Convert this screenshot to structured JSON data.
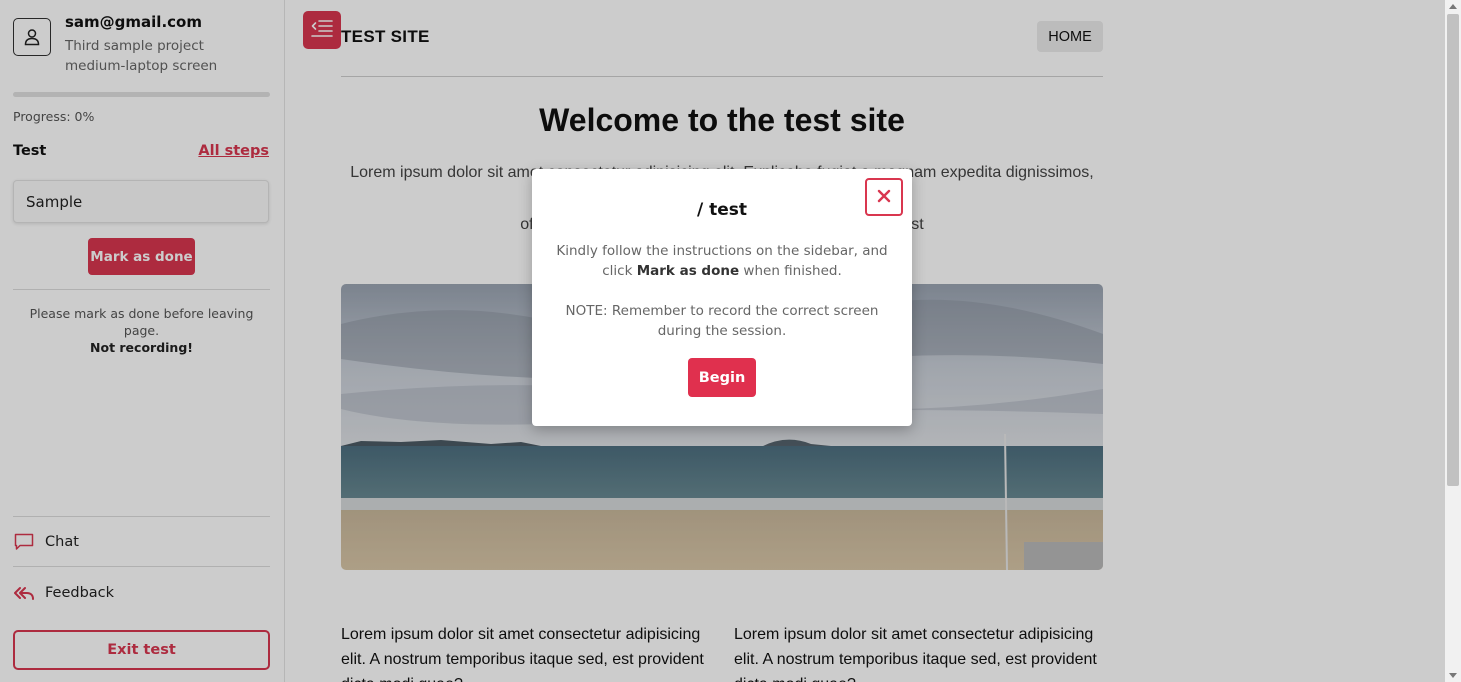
{
  "sidebar": {
    "user_email": "sam@gmail.com",
    "project_name": "Third sample project",
    "screen_type": "medium-laptop screen",
    "progress_value": 0,
    "progress_label": "Progress: 0%",
    "step_title": "Test",
    "all_steps_label": "All steps",
    "step_item": "Sample",
    "mark_done_label": "Mark as done",
    "warning_text": "Please mark as done before leaving page.",
    "warning_bold": "Not recording!",
    "chat_label": "Chat",
    "feedback_label": "Feedback",
    "exit_label": "Exit test",
    "accent_color": "#d9364f",
    "icons": [
      "user-icon",
      "chat-icon",
      "reply-all-icon",
      "menu-collapse-icon"
    ]
  },
  "site": {
    "title": "TEST SITE",
    "home_label": "HOME",
    "hero_title": "Welcome to the test site",
    "hero_text_line1": "Lorem ipsum dolor sit amet consectetur adipisicing elit. Explicabo fugiat a magnam expedita dignissimos, nobis",
    "hero_text_line2": "officiis voluptas fugit dolore ... usdam harum, corporis est",
    "col1_text": "Lorem ipsum dolor sit amet consectetur adipisicing elit. A nostrum temporibus itaque sed, est provident dicta modi quae?",
    "col2_text": "Lorem ipsum dolor sit amet consectetur adipisicing elit. A nostrum temporibus itaque sed, est provident dicta modi quae?"
  },
  "modal": {
    "title": "/ test",
    "instruction_pre": "Kindly follow the instructions on the sidebar, and click ",
    "instruction_bold": "Mark as done",
    "instruction_post": " when finished.",
    "note": "NOTE: Remember to record the correct screen during the session.",
    "begin_label": "Begin",
    "accent_color": "#e0304e"
  }
}
